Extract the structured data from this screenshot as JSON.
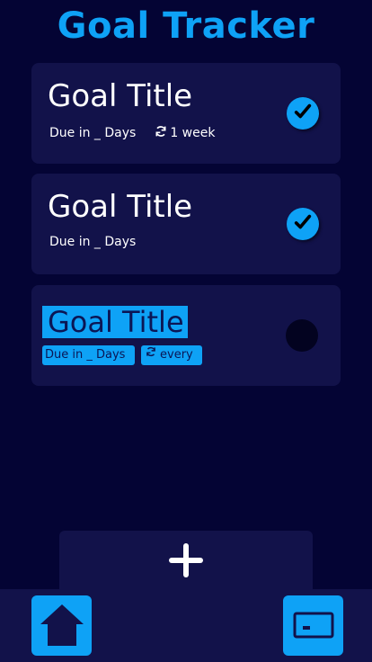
{
  "app": {
    "title": "Goal Tracker",
    "colors": {
      "background": "#040434",
      "card": "#12124a",
      "accent": "#0ea2f6",
      "text": "#ffffff"
    }
  },
  "goals": [
    {
      "title": "Goal Title",
      "due": "Due in _ Days",
      "repeat": "1 week",
      "completed": true
    },
    {
      "title": "Goal Title",
      "due": "Due in _ Days",
      "completed": true
    }
  ],
  "edit_goal": {
    "title": "Goal Title",
    "due": "Due in _ Days",
    "repeat": "every",
    "completed": false
  },
  "actions": {
    "add_icon": "plus-icon"
  },
  "bottom_nav": {
    "items": [
      {
        "name": "home",
        "icon": "home-icon"
      },
      {
        "name": "card",
        "icon": "card-icon"
      }
    ]
  }
}
